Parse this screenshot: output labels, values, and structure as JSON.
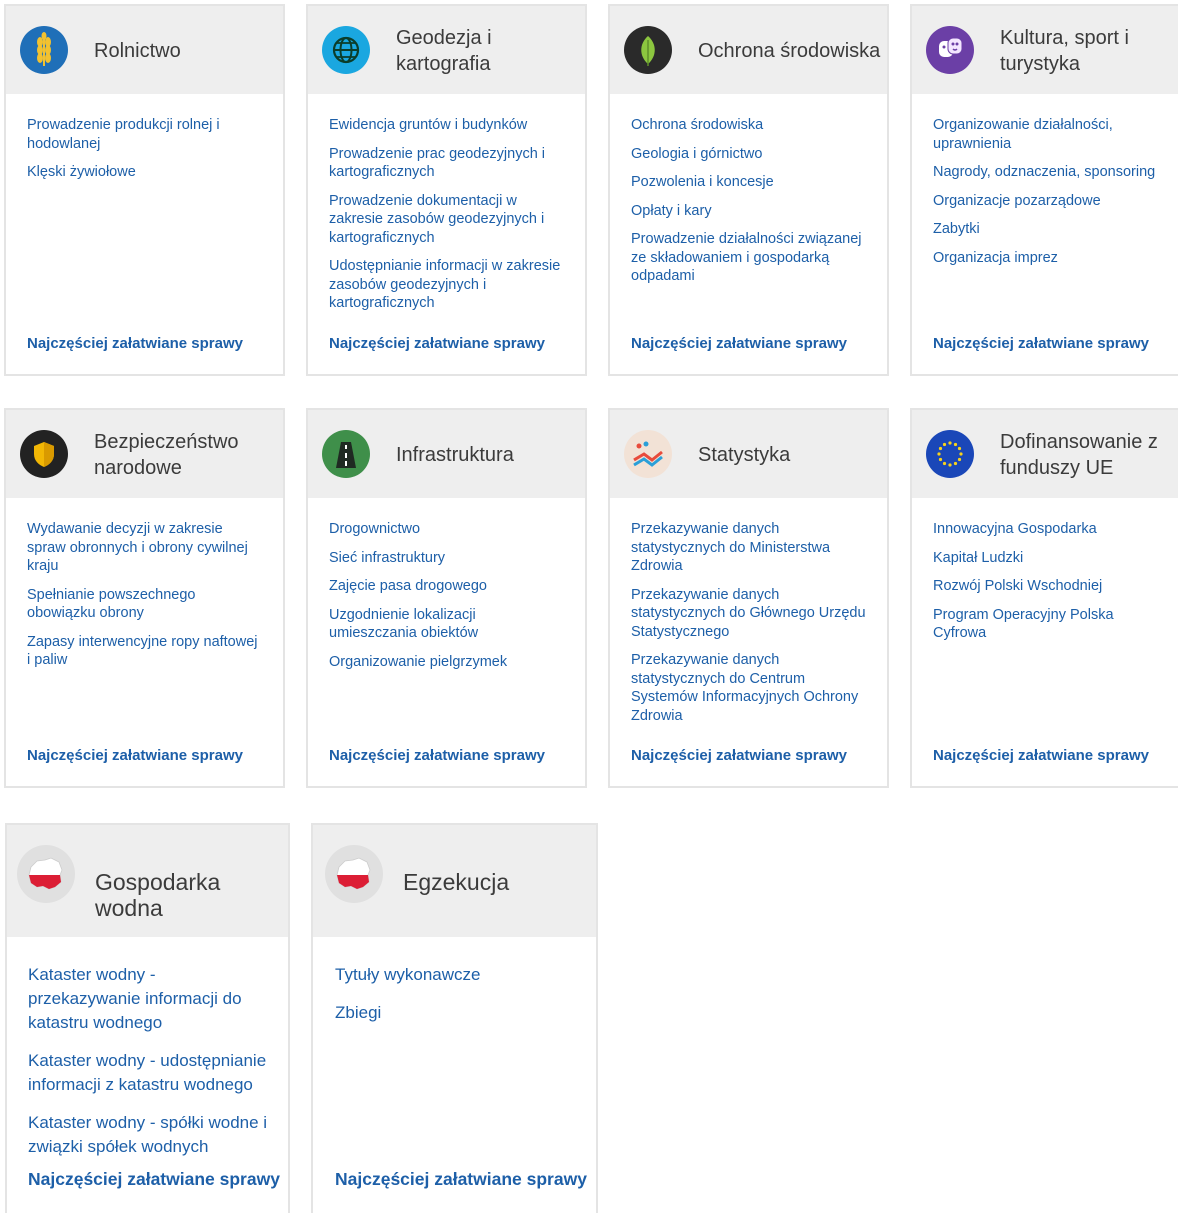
{
  "cards": [
    {
      "title": "Rolnictwo",
      "icon": "wheat-icon",
      "icon_color": "#1f6fb8",
      "links": [
        "Prowadzenie produkcji rolnej i hodowlanej",
        "Klęski żywiołowe"
      ],
      "more": "Najczęściej załatwiane sprawy"
    },
    {
      "title": "Geodezja i kartografia",
      "icon": "globe-icon",
      "icon_color": "#1aa7e0",
      "links": [
        "Ewidencja gruntów i budynków",
        "Prowadzenie prac geodezyjnych i kartograficznych",
        "Prowadzenie dokumentacji w zakresie zasobów geodezyjnych i kartograficznych",
        "Udostępnianie informacji w zakresie zasobów geodezyjnych i kartograficznych"
      ],
      "more": "Najczęściej załatwiane sprawy"
    },
    {
      "title": "Ochrona środowiska",
      "icon": "leaf-icon",
      "icon_color": "#2a2a2a",
      "links": [
        "Ochrona środowiska",
        "Geologia i górnictwo",
        "Pozwolenia i koncesje",
        "Opłaty i kary",
        "Prowadzenie działalności związanej ze składowaniem i gospodarką odpadami"
      ],
      "more": "Najczęściej załatwiane sprawy"
    },
    {
      "title": "Kultura, sport i turystyka",
      "icon": "theater-masks-icon",
      "icon_color": "#6b3fa6",
      "links": [
        "Organizowanie działalności, uprawnienia",
        "Nagrody, odznaczenia, sponsoring",
        "Organizacje pozarządowe",
        "Zabytki",
        "Organizacja imprez"
      ],
      "more": "Najczęściej załatwiane sprawy"
    },
    {
      "title": "Bezpieczeństwo narodowe",
      "icon": "shield-icon",
      "icon_color": "#222222",
      "links": [
        "Wydawanie decyzji w zakresie spraw obronnych i obrony cywilnej kraju",
        "Spełnianie powszechnego obowiązku obrony",
        "Zapasy interwencyjne ropy naftowej i paliw"
      ],
      "more": "Najczęściej załatwiane sprawy"
    },
    {
      "title": "Infrastruktura",
      "icon": "road-icon",
      "icon_color": "#3f8f4a",
      "links": [
        "Drogownictwo",
        "Sieć infrastruktury",
        "Zajęcie pasa drogowego",
        "Uzgodnienie lokalizacji umieszczania obiektów",
        "Organizowanie pielgrzymek"
      ],
      "more": "Najczęściej załatwiane sprawy"
    },
    {
      "title": "Statystyka",
      "icon": "chart-lines-icon",
      "icon_color": "#f2e2d6",
      "links": [
        "Przekazywanie danych statystycznych do Ministerstwa Zdrowia",
        "Przekazywanie danych statystycznych do Głównego Urzędu Statystycznego",
        "Przekazywanie danych statystycznych do Centrum Systemów Informacyjnych Ochrony Zdrowia"
      ],
      "more": "Najczęściej załatwiane sprawy"
    },
    {
      "title": "Dofinansowanie z funduszy UE",
      "icon": "eu-flag-icon",
      "icon_color": "#1a47b8",
      "links": [
        "Innowacyjna Gospodarka",
        "Kapitał Ludzki",
        "Rozwój Polski Wschodniej",
        "Program Operacyjny Polska Cyfrowa"
      ],
      "more": "Najczęściej załatwiane sprawy"
    },
    {
      "title": "Gospodarka wodna",
      "icon": "poland-map-icon",
      "icon_color": "#e0e0e0",
      "links": [
        "Kataster wodny - przekazywanie informacji do katastru wodnego",
        "Kataster wodny - udostępnianie informacji z katastru wodnego",
        "Kataster wodny - spółki wodne i związki spółek wodnych"
      ],
      "more": "Najczęściej załatwiane sprawy"
    },
    {
      "title": "Egzekucja",
      "icon": "poland-map-icon",
      "icon_color": "#e0e0e0",
      "links": [
        "Tytuły wykonawcze",
        "Zbiegi"
      ],
      "more": "Najczęściej załatwiane sprawy"
    }
  ]
}
